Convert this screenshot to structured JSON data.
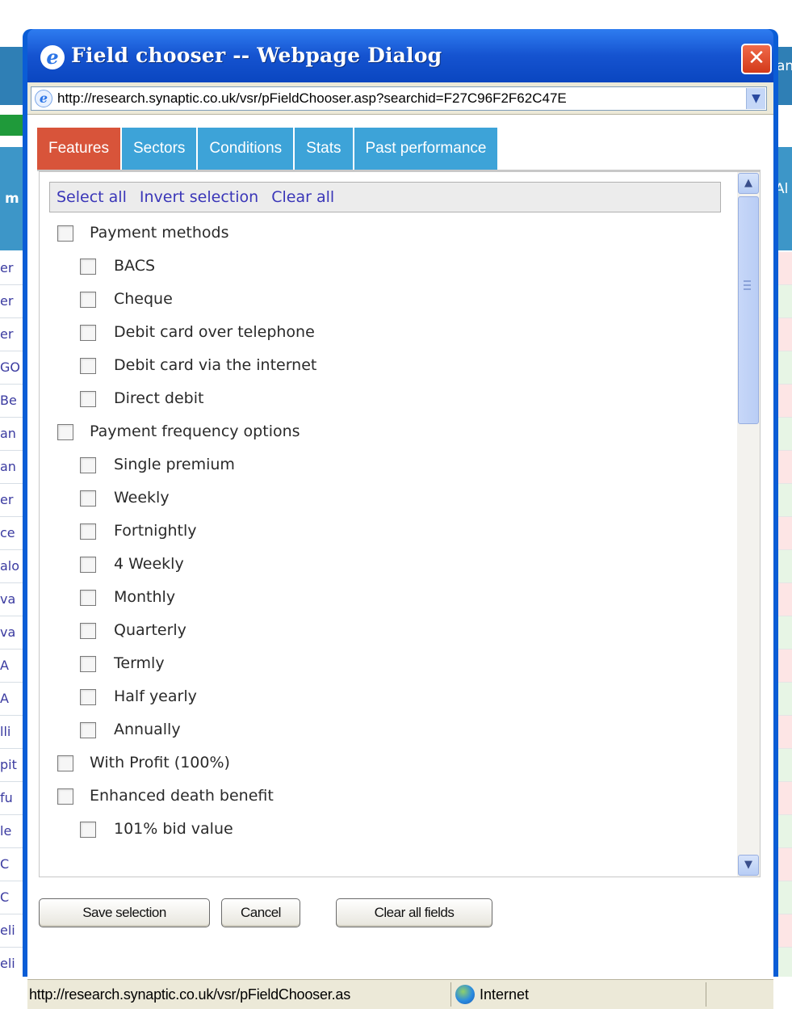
{
  "background_page": {
    "header_cell": "m",
    "header_right": "Al",
    "top_right": "an",
    "row_fragments": [
      "er",
      "er",
      "er",
      "GO",
      "Be",
      "an",
      "an",
      "er",
      "ce",
      "alo",
      "va",
      "va",
      "A",
      "A",
      "lli",
      "pit",
      "fu",
      "le",
      "C",
      "C",
      "eli",
      "eli"
    ]
  },
  "dialog": {
    "title": "Field chooser -- Webpage Dialog",
    "close_label": "✕",
    "url": "http://research.synaptic.co.uk/vsr/pFieldChooser.asp?searchid=F27C96F2F62C47E",
    "tabs": [
      {
        "label": "Features",
        "active": true
      },
      {
        "label": "Sectors",
        "active": false
      },
      {
        "label": "Conditions",
        "active": false
      },
      {
        "label": "Stats",
        "active": false
      },
      {
        "label": "Past performance",
        "active": false
      }
    ],
    "selection_links": {
      "select_all": "Select all",
      "invert": "Invert selection",
      "clear": "Clear all"
    },
    "options": [
      {
        "label": "Payment methods",
        "level": 0
      },
      {
        "label": "BACS",
        "level": 1
      },
      {
        "label": "Cheque",
        "level": 1
      },
      {
        "label": "Debit card over telephone",
        "level": 1
      },
      {
        "label": "Debit card via the internet",
        "level": 1
      },
      {
        "label": "Direct debit",
        "level": 1
      },
      {
        "label": "Payment frequency options",
        "level": 0
      },
      {
        "label": "Single premium",
        "level": 1
      },
      {
        "label": "Weekly",
        "level": 1
      },
      {
        "label": "Fortnightly",
        "level": 1
      },
      {
        "label": "4 Weekly",
        "level": 1
      },
      {
        "label": "Monthly",
        "level": 1
      },
      {
        "label": "Quarterly",
        "level": 1
      },
      {
        "label": "Termly",
        "level": 1
      },
      {
        "label": "Half yearly",
        "level": 1
      },
      {
        "label": "Annually",
        "level": 1
      },
      {
        "label": "With Profit (100%)",
        "level": 0
      },
      {
        "label": "Enhanced death benefit",
        "level": 0
      },
      {
        "label": "101% bid value",
        "level": 1
      }
    ],
    "buttons": {
      "save": "Save selection",
      "cancel": "Cancel",
      "clear_fields": "Clear all fields"
    },
    "status": {
      "url": "http://research.synaptic.co.uk/vsr/pFieldChooser.as",
      "zone": "Internet"
    }
  },
  "colors": {
    "active_tab": "#d8543a",
    "inactive_tab": "#3da3d8",
    "title_bar": "#0a5dd6",
    "link": "#3a36b8"
  }
}
